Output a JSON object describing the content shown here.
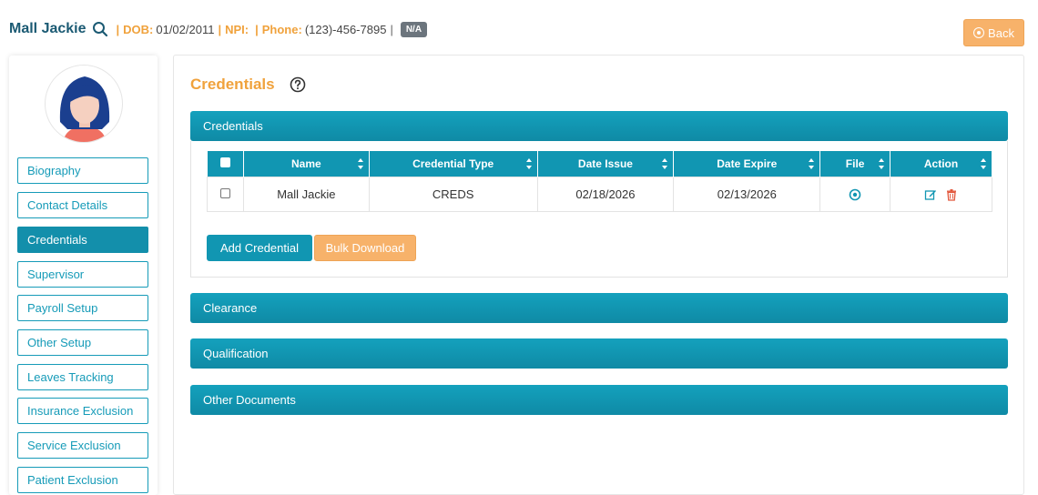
{
  "header": {
    "patient_name": "Mall Jackie",
    "dob_label": "DOB:",
    "dob_value": "01/02/2011",
    "npi_label": "NPI:",
    "npi_value": "",
    "phone_label": "Phone:",
    "phone_value": "(123)-456-7895",
    "badge": "N/A",
    "separator": "|",
    "back_label": "Back"
  },
  "sidebar": {
    "items": [
      {
        "label": "Biography"
      },
      {
        "label": "Contact Details"
      },
      {
        "label": "Credentials",
        "active": true
      },
      {
        "label": "Supervisor"
      },
      {
        "label": "Payroll Setup"
      },
      {
        "label": "Other Setup"
      },
      {
        "label": "Leaves Tracking"
      },
      {
        "label": "Insurance Exclusion"
      },
      {
        "label": "Service Exclusion"
      },
      {
        "label": "Patient Exclusion"
      }
    ]
  },
  "main": {
    "title": "Credentials",
    "panels": [
      {
        "title": "Credentials"
      },
      {
        "title": "Clearance"
      },
      {
        "title": "Qualification"
      },
      {
        "title": "Other Documents"
      }
    ],
    "table": {
      "columns": [
        "Name",
        "Credential Type",
        "Date Issue",
        "Date Expire",
        "File",
        "Action"
      ],
      "rows": [
        {
          "name": "Mall Jackie",
          "type": "CREDS",
          "issue": "02/18/2026",
          "expire": "02/13/2026"
        }
      ]
    },
    "add_button": "Add Credential",
    "bulk_button": "Bulk Download"
  },
  "colors": {
    "accent": "#1196b2",
    "orange": "#f0a23c",
    "delete": "#e2563b"
  }
}
